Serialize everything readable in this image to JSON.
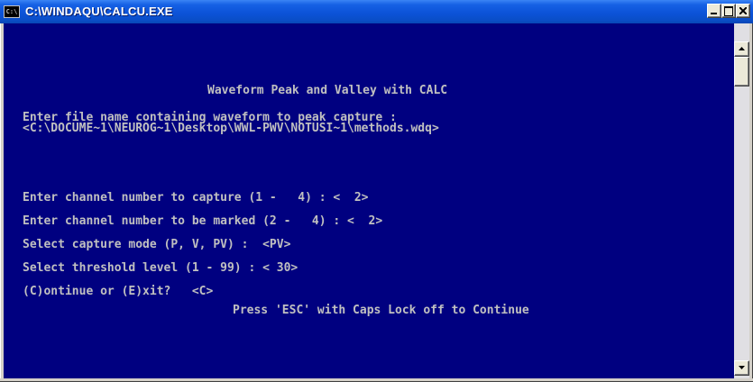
{
  "window": {
    "title": "C:\\WINDAQU\\CALCU.EXE",
    "icon_label": "C:\\"
  },
  "colors": {
    "console_background": "#000080",
    "console_text": "#c0c0c0",
    "titlebar": "#0c53d8"
  },
  "icons": {
    "app": "console-window-icon",
    "minimize": "minimize-icon",
    "maximize": "maximize-icon",
    "close": "close-icon",
    "scroll_up": "arrow-up-icon",
    "scroll_down": "arrow-down-icon"
  },
  "console": {
    "heading": "Waveform Peak and Valley with CALC",
    "file_prompt": "Enter file name containing waveform to peak capture :",
    "file_path": "<C:\\DOCUME~1\\NEUROG~1\\Desktop\\WWL-PWV\\NOTUSI~1\\methods.wdq>",
    "channel_prompt": "Enter channel number to capture (1 -   4) : <  2>",
    "mark_prompt": "Enter channel number to be marked (2 -   4) : <  2>",
    "mode_prompt": "Select capture mode (P, V, PV) :  <PV>",
    "threshold_prompt": "Select threshold level (1 - 99) : < 30>",
    "continue_prompt": "(C)ontinue or (E)xit?   <C>",
    "esc_hint": "Press 'ESC' with Caps Lock off to Continue"
  }
}
